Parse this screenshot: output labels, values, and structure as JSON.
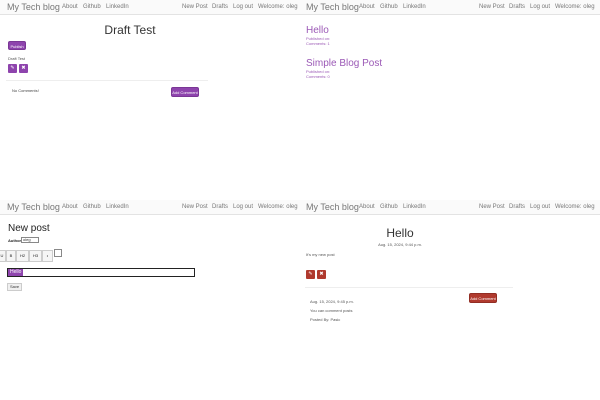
{
  "nav": {
    "brand": "My Tech blog",
    "about": "About",
    "github": "Github",
    "linkedin": "LinkedIn",
    "new_post": "New Post",
    "drafts": "Drafts",
    "logout": "Log out",
    "welcome": "Welcome: oleg"
  },
  "draft_view": {
    "title": "Draft Test",
    "publish_label": "Publish",
    "body": "Draft Test",
    "edit_icon": "pencil-icon",
    "delete_icon": "trash-icon",
    "no_comments": "No Comments!",
    "add_comment": "Add Comment"
  },
  "post_list": {
    "posts": [
      {
        "title": "Hello",
        "published": "Published on:",
        "comments": "Comments: 1"
      },
      {
        "title": "Simple Blog Post",
        "published": "Published on:",
        "comments": "Comments: 0"
      }
    ]
  },
  "new_post": {
    "heading": "New post",
    "author_label": "Author:",
    "author_value": "oleg",
    "toolbar": [
      "U",
      "B",
      "H2",
      "H3",
      "•"
    ],
    "title_value": "Hello",
    "save_label": "Save"
  },
  "post_detail": {
    "title": "Hello",
    "date": "Aug. 15, 2024, 9:44 p.m.",
    "body": "It's my new post",
    "add_comment": "Add Comment",
    "comment": {
      "date": "Aug. 15, 2024, 9:45 p.m.",
      "text": "You can comment posts",
      "posted_by": "Posted By: Pasic"
    }
  },
  "colors": {
    "accent": "#8e44ad",
    "danger": "#b03a2e",
    "link": "#9b59b6"
  }
}
